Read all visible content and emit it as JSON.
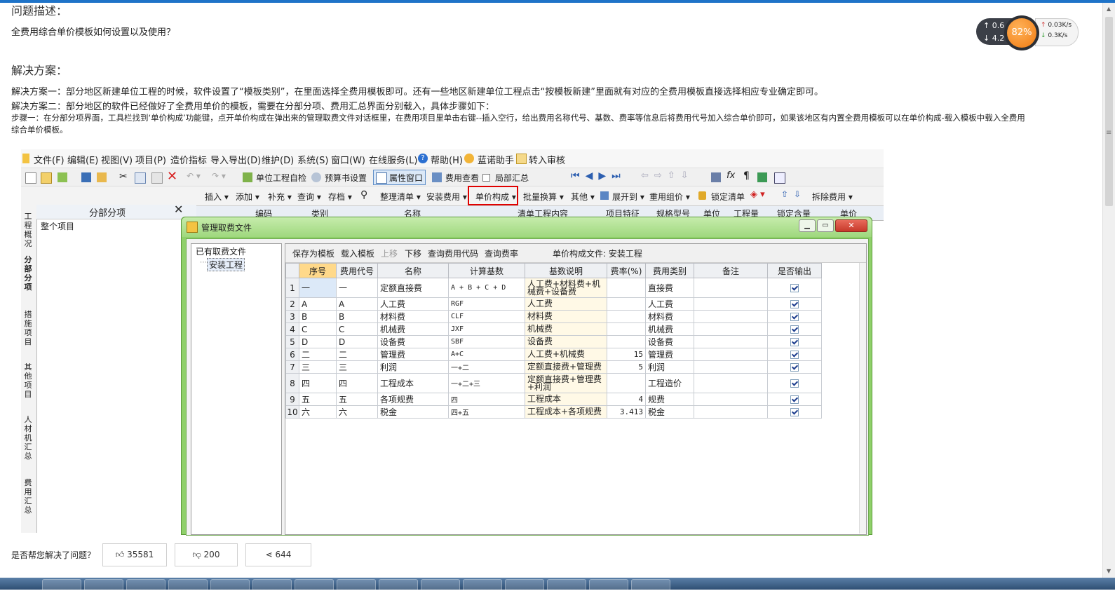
{
  "page": {
    "problem_heading": "问题描述：",
    "problem_text": "全费用综合单价模板如何设置以及使用？",
    "solution_heading": "解决方案：",
    "solution_line1": "解决方案一：部分地区新建单位工程的时候，软件设置了“模板类别”，在里面选择全费用模板即可。还有一些地区新建单位工程点击“按模板新建”里面就有对应的全费用模板直接选择相应专业确定即可。",
    "solution_line2": "解决方案二：部分地区的软件已经做好了全费用单价的模板，需要在分部分项、费用汇总界面分别载入，具体步骤如下：",
    "step1_line1": "步骤一：在分部分项界面，工具栏找到‘单价构成’功能键，点开单价构成在弹出来的管理取费文件对话框里，在费用项目里单击右键--插入空行，给出费用名称代号、基数、费率等信息后将费用代号加入综合单价即可，如果该地区有内置全费用模板可以在单价构成-载入模板中载入全费用",
    "step1_line2": "综合单价模板。"
  },
  "speed_widget": {
    "percent": "82%",
    "left_up": "0.6",
    "left_down": "4.2",
    "right_up": "0.03K/s",
    "right_down": "0.3K/s"
  },
  "app": {
    "menu": [
      "文件(F)",
      "编辑(E)",
      "视图(V)",
      "项目(P)",
      "造价指标",
      "导入导出(D)",
      "维护(D)",
      "系统(S)",
      "窗口(W)",
      "在线服务(L)",
      "帮助(H)",
      "蓝诺助手",
      "转入审核"
    ],
    "toolbar1": {
      "unit_check": "单位工程自检",
      "budget_settings": "预算书设置",
      "attr_window": "属性窗口",
      "fee_view": "费用查看",
      "partial_summary": "局部汇总"
    },
    "toolbar2": [
      "插入",
      "添加",
      "补充",
      "查询",
      "存档",
      "整理清单",
      "安装费用",
      "单价构成",
      "批量换算",
      "其他",
      "展开到",
      "重用组价",
      "锁定清单",
      "拆除费用"
    ],
    "left_pane_title": "分部分项",
    "left_pane_item": "整个项目",
    "vertical_tabs": [
      "工程概况",
      "分部分项",
      "措施项目",
      "其他项目",
      "人材机汇总",
      "费用汇总"
    ],
    "grid_headers": [
      "编码",
      "类别",
      "名称",
      "清单工程内容",
      "项目特征",
      "规格型号",
      "单位",
      "工程量",
      "锁定含量",
      "单价"
    ]
  },
  "dialog": {
    "title": "管理取费文件",
    "tree_title": "已有取费文件",
    "tree_item": "安装工程",
    "tools": [
      "保存为模板",
      "载入模板",
      "上移",
      "下移",
      "查询费用代码",
      "查询费率"
    ],
    "file_label": "单价构成文件: 安装工程",
    "columns": [
      "序号",
      "费用代号",
      "名称",
      "计算基数",
      "基数说明",
      "费率(%)",
      "费用类别",
      "备注",
      "是否输出"
    ],
    "rows": [
      {
        "n": "1",
        "seq": "一",
        "code": "一",
        "name": "定额直接费",
        "base": "A + B + C + D",
        "desc": "人工费+材料费+机械费+设备费",
        "rate": "",
        "cat": "直接费",
        "note": ""
      },
      {
        "n": "2",
        "seq": "A",
        "code": "A",
        "name": "人工费",
        "base": "RGF",
        "desc": "人工费",
        "rate": "",
        "cat": "人工费",
        "note": ""
      },
      {
        "n": "3",
        "seq": "B",
        "code": "B",
        "name": "材料费",
        "base": "CLF",
        "desc": "材料费",
        "rate": "",
        "cat": "材料费",
        "note": ""
      },
      {
        "n": "4",
        "seq": "C",
        "code": "C",
        "name": "机械费",
        "base": "JXF",
        "desc": "机械费",
        "rate": "",
        "cat": "机械费",
        "note": ""
      },
      {
        "n": "5",
        "seq": "D",
        "code": "D",
        "name": "设备费",
        "base": "SBF",
        "desc": "设备费",
        "rate": "",
        "cat": "设备费",
        "note": ""
      },
      {
        "n": "6",
        "seq": "二",
        "code": "二",
        "name": "管理费",
        "base": "A+C",
        "desc": "人工费+机械费",
        "rate": "15",
        "cat": "管理费",
        "note": ""
      },
      {
        "n": "7",
        "seq": "三",
        "code": "三",
        "name": "利润",
        "base": "一+二",
        "desc": "定额直接费+管理费",
        "rate": "5",
        "cat": "利润",
        "note": ""
      },
      {
        "n": "8",
        "seq": "四",
        "code": "四",
        "name": "工程成本",
        "base": "一+二+三",
        "desc": "定额直接费+管理费+利润",
        "rate": "",
        "cat": "工程造价",
        "note": ""
      },
      {
        "n": "9",
        "seq": "五",
        "code": "五",
        "name": "各项规费",
        "base": "四",
        "desc": "工程成本",
        "rate": "4",
        "cat": "规费",
        "note": ""
      },
      {
        "n": "10",
        "seq": "六",
        "code": "六",
        "name": "税金",
        "base": "四+五",
        "desc": "工程成本+各项规费",
        "rate": "3.413",
        "cat": "税金",
        "note": ""
      }
    ]
  },
  "feedback": {
    "question": "是否帮您解决了问题？",
    "like": "35581",
    "dislike": "200",
    "share": "644"
  },
  "colors": {
    "accent": "#1e73c8",
    "highlight_box": "#e00000",
    "dialog_frame": "#8fd06a"
  }
}
